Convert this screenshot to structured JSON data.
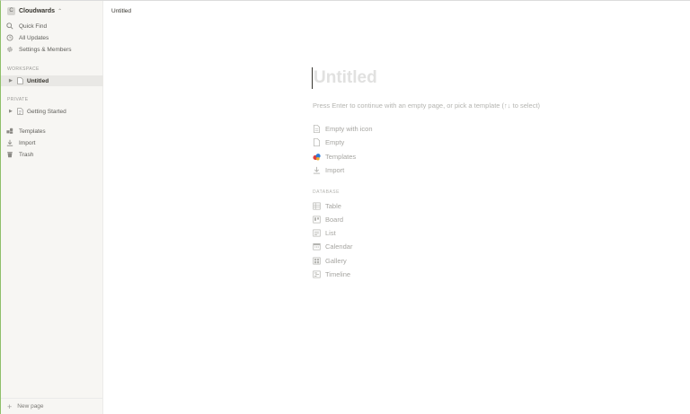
{
  "workspace": {
    "avatar_letter": "C",
    "name": "Cloudwards",
    "chevron": "⌃"
  },
  "sidebar": {
    "nav": [
      {
        "label": "Quick Find",
        "icon": "search-icon"
      },
      {
        "label": "All Updates",
        "icon": "clock-icon"
      },
      {
        "label": "Settings & Members",
        "icon": "gear-icon"
      }
    ],
    "workspace_label": "WORKSPACE",
    "workspace_pages": [
      {
        "label": "Untitled",
        "active": true
      }
    ],
    "private_label": "PRIVATE",
    "private_pages": [
      {
        "label": "Getting Started"
      }
    ],
    "tools": [
      {
        "label": "Templates",
        "icon": "templates-icon"
      },
      {
        "label": "Import",
        "icon": "import-icon"
      },
      {
        "label": "Trash",
        "icon": "trash-icon"
      }
    ],
    "new_page_label": "New page"
  },
  "topbar": {
    "breadcrumb": "Untitled"
  },
  "editor": {
    "title_placeholder": "Untitled",
    "hint": "Press Enter to continue with an empty page, or pick a template (↑↓ to select)",
    "options": [
      {
        "label": "Empty with icon",
        "icon": "page-with-icon-icon"
      },
      {
        "label": "Empty",
        "icon": "page-icon"
      },
      {
        "label": "Templates",
        "icon": "templates-color-icon"
      },
      {
        "label": "Import",
        "icon": "import-icon"
      }
    ],
    "database_label": "DATABASE",
    "database_options": [
      {
        "label": "Table",
        "icon": "table-icon"
      },
      {
        "label": "Board",
        "icon": "board-icon"
      },
      {
        "label": "List",
        "icon": "list-icon"
      },
      {
        "label": "Calendar",
        "icon": "calendar-icon"
      },
      {
        "label": "Gallery",
        "icon": "gallery-icon"
      },
      {
        "label": "Timeline",
        "icon": "timeline-icon"
      }
    ]
  },
  "colors": {
    "sidebar_bg": "#f7f6f3",
    "active_item_bg": "#e9e8e5",
    "text": "#37352f",
    "muted": "#a6a5a1"
  }
}
